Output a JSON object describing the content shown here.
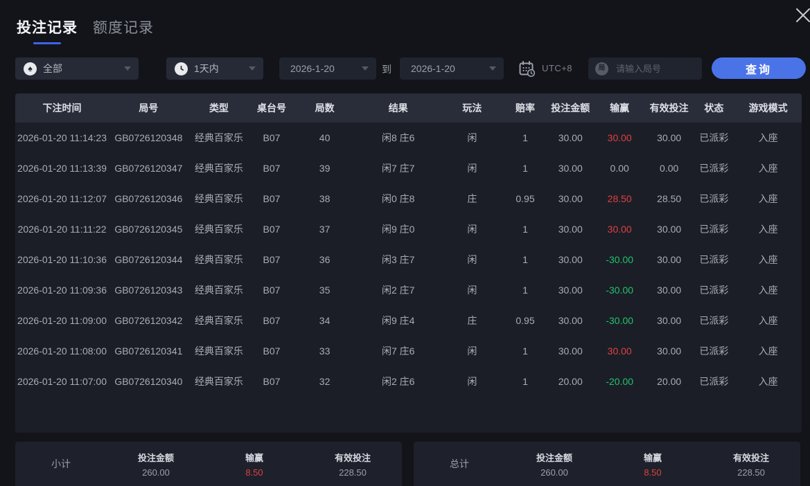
{
  "colors": {
    "accent": "#4a73e8",
    "win_red": "#e04040",
    "loss_green": "#22c36b",
    "tab_underline": "#3e63f0"
  },
  "icons": {
    "close": "close-x",
    "game_filter": "spade",
    "game_filter_char": "♠",
    "time_filter": "clock",
    "timezone": "calendar-clock",
    "dropdown": "caret-down",
    "round_input_char": "局"
  },
  "tabs": [
    {
      "label": "投注记录",
      "active": true
    },
    {
      "label": "额度记录",
      "active": false
    }
  ],
  "filters": {
    "game_type": "全部",
    "time_range": "1天内",
    "date_from": "2026-1-20",
    "to_label": "到",
    "date_to": "2026-1-20",
    "timezone": "UTC+8",
    "round_placeholder": "请输入局号",
    "query_label": "查询"
  },
  "table": {
    "headers": [
      "下注时间",
      "局号",
      "类型",
      "桌台号",
      "局数",
      "结果",
      "玩法",
      "赔率",
      "投注金额",
      "输赢",
      "有效投注",
      "状态",
      "游戏模式"
    ],
    "rows": [
      {
        "cells": [
          "2026-01-20 11:14:23",
          "GB0726120348",
          "经典百家乐",
          "B07",
          "40",
          "闲8 庄6",
          "闲",
          "1",
          "30.00",
          "30.00",
          "30.00",
          "已派彩",
          "入座"
        ],
        "winloss_tone": "pos"
      },
      {
        "cells": [
          "2026-01-20 11:13:39",
          "GB0726120347",
          "经典百家乐",
          "B07",
          "39",
          "闲7 庄7",
          "闲",
          "1",
          "30.00",
          "0.00",
          "0.00",
          "已派彩",
          "入座"
        ],
        "winloss_tone": "zero"
      },
      {
        "cells": [
          "2026-01-20 11:12:07",
          "GB0726120346",
          "经典百家乐",
          "B07",
          "38",
          "闲0 庄8",
          "庄",
          "0.95",
          "30.00",
          "28.50",
          "28.50",
          "已派彩",
          "入座"
        ],
        "winloss_tone": "pos"
      },
      {
        "cells": [
          "2026-01-20 11:11:22",
          "GB0726120345",
          "经典百家乐",
          "B07",
          "37",
          "闲9 庄0",
          "闲",
          "1",
          "30.00",
          "30.00",
          "30.00",
          "已派彩",
          "入座"
        ],
        "winloss_tone": "pos"
      },
      {
        "cells": [
          "2026-01-20 11:10:36",
          "GB0726120344",
          "经典百家乐",
          "B07",
          "36",
          "闲3 庄7",
          "闲",
          "1",
          "30.00",
          "-30.00",
          "30.00",
          "已派彩",
          "入座"
        ],
        "winloss_tone": "neg"
      },
      {
        "cells": [
          "2026-01-20 11:09:36",
          "GB0726120343",
          "经典百家乐",
          "B07",
          "35",
          "闲2 庄7",
          "闲",
          "1",
          "30.00",
          "-30.00",
          "30.00",
          "已派彩",
          "入座"
        ],
        "winloss_tone": "neg"
      },
      {
        "cells": [
          "2026-01-20 11:09:00",
          "GB0726120342",
          "经典百家乐",
          "B07",
          "34",
          "闲9 庄4",
          "庄",
          "0.95",
          "30.00",
          "-30.00",
          "30.00",
          "已派彩",
          "入座"
        ],
        "winloss_tone": "neg"
      },
      {
        "cells": [
          "2026-01-20 11:08:00",
          "GB0726120341",
          "经典百家乐",
          "B07",
          "33",
          "闲7 庄6",
          "闲",
          "1",
          "30.00",
          "30.00",
          "30.00",
          "已派彩",
          "入座"
        ],
        "winloss_tone": "pos"
      },
      {
        "cells": [
          "2026-01-20 11:07:00",
          "GB0726120340",
          "经典百家乐",
          "B07",
          "32",
          "闲2 庄6",
          "闲",
          "1",
          "20.00",
          "-20.00",
          "20.00",
          "已派彩",
          "入座"
        ],
        "winloss_tone": "neg"
      }
    ]
  },
  "summary": {
    "subtotal": {
      "title": "小计",
      "items": [
        {
          "label": "投注金额",
          "value": "260.00",
          "tone": ""
        },
        {
          "label": "输赢",
          "value": "8.50",
          "tone": "pos"
        },
        {
          "label": "有效投注",
          "value": "228.50",
          "tone": ""
        }
      ]
    },
    "total": {
      "title": "总计",
      "items": [
        {
          "label": "投注金额",
          "value": "260.00",
          "tone": ""
        },
        {
          "label": "输赢",
          "value": "8.50",
          "tone": "pos"
        },
        {
          "label": "有效投注",
          "value": "228.50",
          "tone": ""
        }
      ]
    }
  }
}
